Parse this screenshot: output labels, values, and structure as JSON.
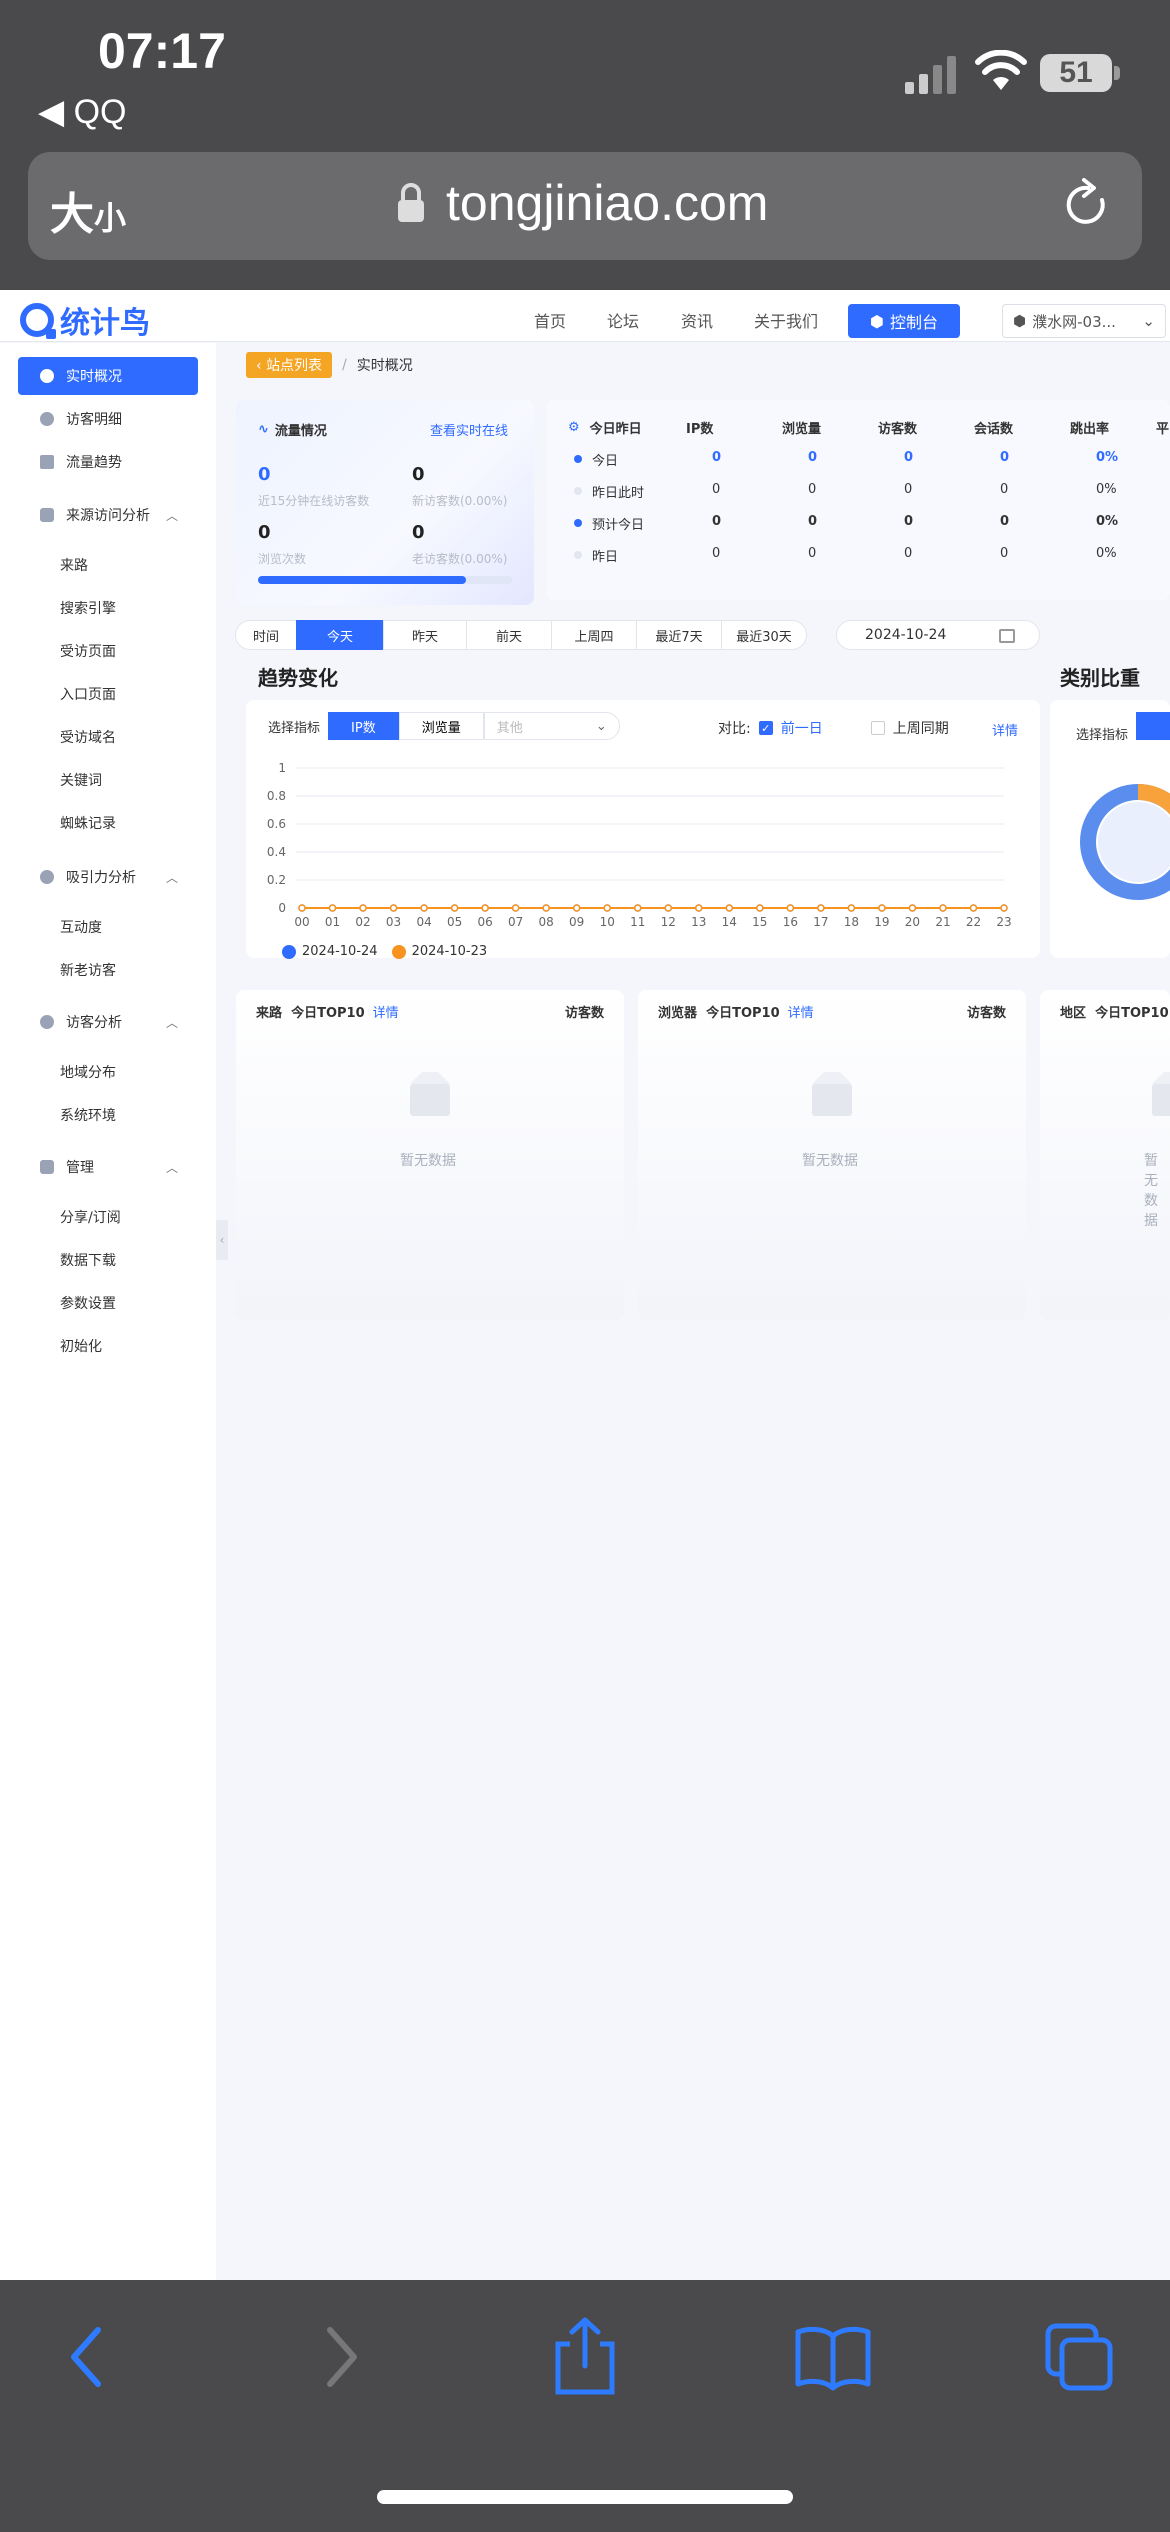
{
  "status_bar": {
    "time": "07:17",
    "back_app": "◀ QQ",
    "battery": "51"
  },
  "url_bar": {
    "text_size_label": "大",
    "text_size_small": "小",
    "domain": "tongjiniao.com"
  },
  "site": {
    "logo": "统计鸟",
    "nav": [
      "首页",
      "论坛",
      "资讯",
      "关于我们"
    ],
    "console_button": "控制台",
    "site_select": "濮水网-03..."
  },
  "sidebar": {
    "active": "实时概况",
    "items": [
      {
        "label": "访客明细"
      },
      {
        "label": "流量趋势"
      }
    ],
    "groups": [
      {
        "label": "来源访问分析",
        "children": [
          "来路",
          "搜索引擎",
          "受访页面",
          "入口页面",
          "受访域名",
          "关键词",
          "蜘蛛记录"
        ]
      },
      {
        "label": "吸引力分析",
        "children": [
          "互动度",
          "新老访客"
        ]
      },
      {
        "label": "访客分析",
        "children": [
          "地域分布",
          "系统环境"
        ]
      },
      {
        "label": "管理",
        "children": [
          "分享/订阅",
          "数据下载",
          "参数设置",
          "初始化"
        ]
      }
    ]
  },
  "breadcrumb": {
    "back_button": "站点列表",
    "current": "实时概况"
  },
  "flow": {
    "title": "流量情况",
    "link": "查看实时在线",
    "online": {
      "value": "0",
      "label": "近15分钟在线访客数"
    },
    "new_visitors": {
      "value": "0",
      "label": "新访客数(0.00%)"
    },
    "page_views": {
      "value": "0",
      "label": "浏览次数"
    },
    "old_visitors": {
      "value": "0",
      "label": "老访客数(0.00%)"
    },
    "progress": 0.82
  },
  "stats_table": {
    "title": "今日昨日",
    "headers": [
      "IP数",
      "浏览量",
      "访客数",
      "会话数",
      "跳出率",
      "平"
    ],
    "rows": [
      {
        "label": "今日",
        "values": [
          "0",
          "0",
          "0",
          "0",
          "0%"
        ]
      },
      {
        "label": "昨日此时",
        "values": [
          "0",
          "0",
          "0",
          "0",
          "0%"
        ]
      },
      {
        "label": "预计今日",
        "values": [
          "0",
          "0",
          "0",
          "0",
          "0%"
        ]
      },
      {
        "label": "昨日",
        "values": [
          "0",
          "0",
          "0",
          "0",
          "0%"
        ]
      }
    ]
  },
  "time_tabs": {
    "label": "时间",
    "items": [
      "今天",
      "昨天",
      "前天",
      "上周四",
      "最近7天",
      "最近30天"
    ],
    "active": "今天",
    "date": "2024-10-24"
  },
  "trend": {
    "title": "趋势变化",
    "metric_label": "选择指标",
    "metrics": [
      "IP数",
      "浏览量"
    ],
    "other_placeholder": "其他",
    "compare_label": "对比:",
    "compare_options": [
      {
        "label": "前一日",
        "checked": true
      },
      {
        "label": "上周同期",
        "checked": false
      }
    ],
    "detail": "详情"
  },
  "chart_data": {
    "type": "line",
    "x": [
      "00",
      "01",
      "02",
      "03",
      "04",
      "05",
      "06",
      "07",
      "08",
      "09",
      "10",
      "11",
      "12",
      "13",
      "14",
      "15",
      "16",
      "17",
      "18",
      "19",
      "20",
      "21",
      "22",
      "23"
    ],
    "y_ticks": [
      "0",
      "0.2",
      "0.4",
      "0.6",
      "0.8",
      "1"
    ],
    "ylim": [
      0,
      1
    ],
    "series": [
      {
        "name": "2024-10-24",
        "color": "#2f6bff",
        "values": [
          0,
          0,
          0,
          0,
          0,
          0,
          0,
          0,
          0,
          0,
          0,
          0,
          0,
          0,
          0,
          0,
          0,
          0,
          0,
          0,
          0,
          0,
          0,
          0
        ]
      },
      {
        "name": "2024-10-23",
        "color": "#f7931e",
        "values": [
          0,
          0,
          0,
          0,
          0,
          0,
          0,
          0,
          0,
          0,
          0,
          0,
          0,
          0,
          0,
          0,
          0,
          0,
          0,
          0,
          0,
          0,
          0,
          0
        ]
      }
    ]
  },
  "category": {
    "title": "类别比重",
    "metric_label": "选择指标"
  },
  "top_cards": [
    {
      "title": "来路",
      "subtitle": "今日TOP10",
      "link": "详情",
      "right": "访客数",
      "empty": "暂无数据"
    },
    {
      "title": "浏览器",
      "subtitle": "今日TOP10",
      "link": "详情",
      "right": "访客数",
      "empty": "暂无数据"
    },
    {
      "title": "地区",
      "subtitle": "今日TOP10",
      "empty": "暂无数据"
    }
  ],
  "colors": {
    "accent": "#2f6bff",
    "orange": "#f7931e",
    "breadcrumb": "#f5a524"
  }
}
